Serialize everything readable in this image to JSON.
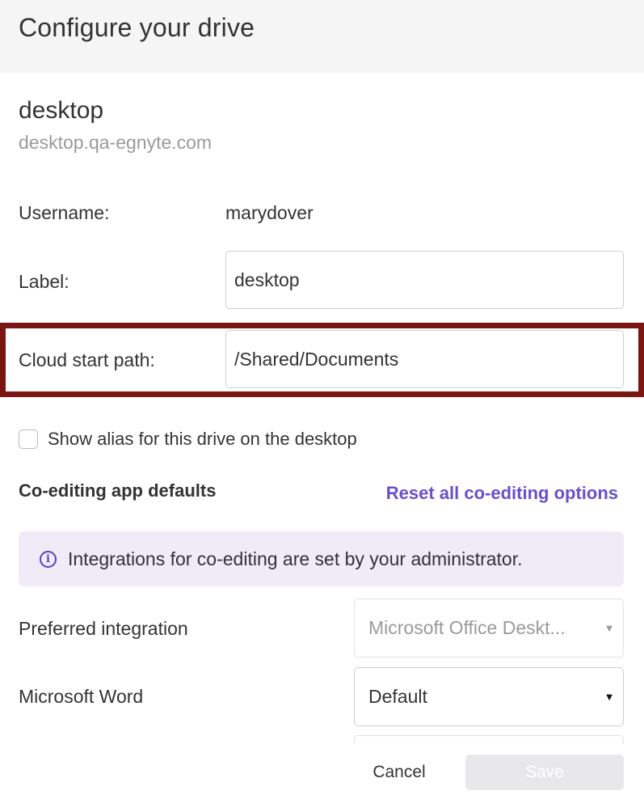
{
  "header": {
    "title": "Configure your drive"
  },
  "drive": {
    "name": "desktop",
    "host": "desktop.qa-egnyte.com"
  },
  "fields": {
    "username_label": "Username:",
    "username_value": "marydover",
    "label_label": "Label:",
    "label_value": "desktop",
    "cloud_path_label": "Cloud start path:",
    "cloud_path_value": "/Shared/Documents"
  },
  "alias_checkbox": {
    "label": "Show alias for this drive on the desktop",
    "checked": false
  },
  "coediting": {
    "title": "Co-editing app defaults",
    "reset_label": "Reset all co-editing options",
    "info_text": "Integrations for co-editing are set by your administrator.",
    "preferred_label": "Preferred integration",
    "preferred_value": "Microsoft Office Deskt...",
    "word_label": "Microsoft Word",
    "word_value": "Default"
  },
  "footer": {
    "cancel_label": "Cancel",
    "save_label": "Save"
  },
  "icons": {
    "info": "info-circle-icon",
    "dropdown": "caret-down-icon"
  },
  "colors": {
    "accent": "#6a4fc9",
    "highlight_border": "#7a1511",
    "info_bg": "#efecf8"
  }
}
